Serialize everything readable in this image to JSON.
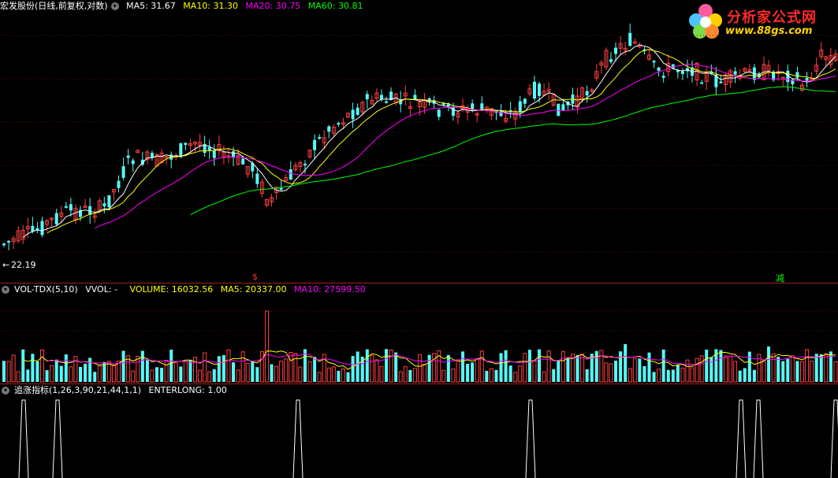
{
  "main": {
    "title": "宏发股份(日线,前复权,对数)",
    "ma5": "MA5: 31.67",
    "ma10": "MA10: 31.30",
    "ma20": "MA20: 30.75",
    "ma60": "MA60: 30.81",
    "low_label": "22.19",
    "marker_s": "$",
    "marker_jian": "减"
  },
  "volume": {
    "title": "VOL-TDX(5,10)",
    "vvol": "VVOL: -",
    "volume": "VOLUME: 16032.56",
    "ma5": "MA5: 20337.00",
    "ma10": "MA10: 27599.50"
  },
  "indicator": {
    "title": "追涨指标(1,26,3,90,21,44,1,1)",
    "enterlong": "ENTERLONG: 1.00"
  },
  "logo": {
    "title": "分析家公式网",
    "url": "www.88gs.com"
  },
  "colors": {
    "up": "#ff4040",
    "down": "#54fcfc",
    "ma5": "#ffffff",
    "ma10": "#ffff00",
    "ma20": "#ff00ff",
    "ma60": "#00ff00",
    "separator": "#a02020"
  }
}
